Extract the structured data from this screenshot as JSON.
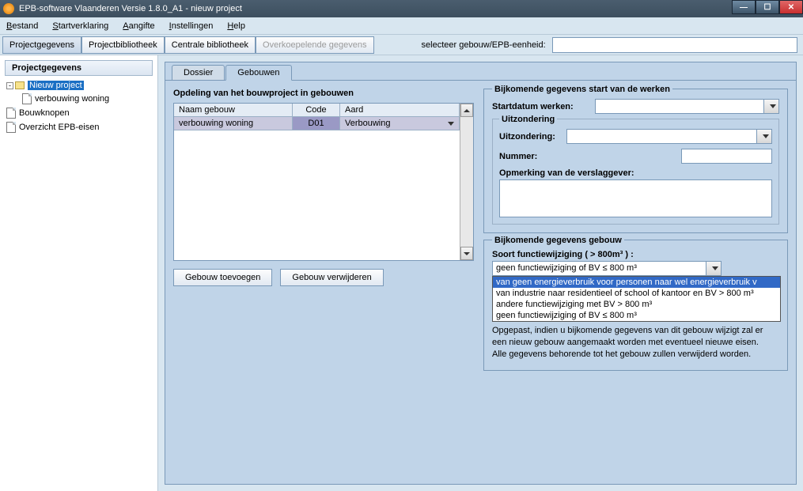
{
  "window": {
    "title": "EPB-software Vlaanderen Versie 1.8.0_A1 - nieuw project"
  },
  "menu": {
    "bestand": "Bestand",
    "startverklaring": "Startverklaring",
    "aangifte": "Aangifte",
    "instellingen": "Instellingen",
    "help": "Help"
  },
  "toolbar": {
    "projectgegevens": "Projectgegevens",
    "projectbibliotheek": "Projectbibliotheek",
    "centrale": "Centrale bibliotheek",
    "overkoepelende": "Overkoepelende gegevens",
    "selecteer_label": "selecteer gebouw/EPB-eenheid:"
  },
  "sidebar": {
    "header": "Projectgegevens",
    "items": [
      {
        "label": "Nieuw project",
        "selected": true,
        "icon": "folder",
        "indent": 0
      },
      {
        "label": "verbouwing woning",
        "selected": false,
        "icon": "doc",
        "indent": 1
      },
      {
        "label": "Bouwknopen",
        "selected": false,
        "icon": "doc",
        "indent": 0
      },
      {
        "label": "Overzicht EPB-eisen",
        "selected": false,
        "icon": "doc",
        "indent": 0
      }
    ]
  },
  "inner_tabs": {
    "dossier": "Dossier",
    "gebouwen": "Gebouwen"
  },
  "opdeling": {
    "title": "Opdeling van het bouwproject in gebouwen",
    "columns": {
      "naam": "Naam gebouw",
      "code": "Code",
      "aard": "Aard"
    },
    "row": {
      "naam": "verbouwing woning",
      "code": "D01",
      "aard": "Verbouwing"
    },
    "add": "Gebouw toevoegen",
    "remove": "Gebouw verwijderen"
  },
  "start_werken": {
    "legend": "Bijkomende gegevens start van de werken",
    "startdatum_label": "Startdatum werken:",
    "uitzondering_legend": "Uitzondering",
    "uitzondering_label": "Uitzondering:",
    "nummer_label": "Nummer:",
    "opmerking_label": "Opmerking van de verslaggever:"
  },
  "gebouw": {
    "legend": "Bijkomende gegevens gebouw",
    "soort_label": "Soort functiewijziging ( > 800m³ ) :",
    "selected": "geen functiewijziging of BV ≤  800 m³",
    "options": [
      "van geen energieverbruik voor personen naar wel energieverbruik v",
      "van industrie naar residentieel of school of kantoor en BV > 800 m³",
      "andere functiewijziging met BV > 800 m³",
      "geen functiewijziging of BV ≤  800 m³"
    ],
    "warning": "Opgepast, indien u bijkomende gegevens van dit gebouw wijzigt zal er een nieuw gebouw aangemaakt worden met eventueel nieuwe eisen.\nAlle gegevens behorende tot het gebouw zullen verwijderd worden."
  }
}
